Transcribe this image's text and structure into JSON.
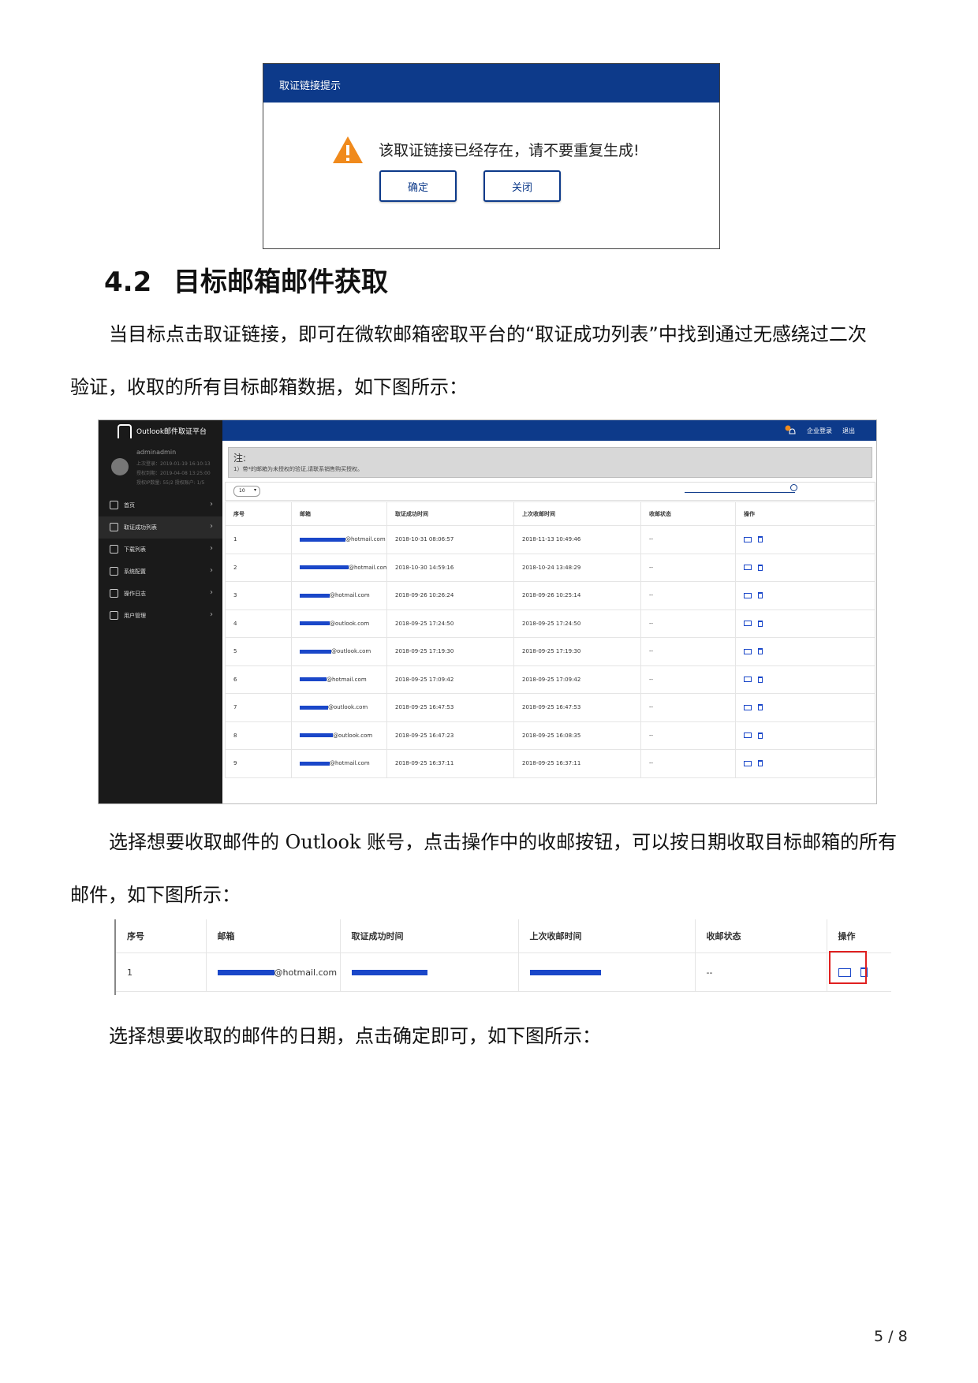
{
  "dialog": {
    "title": "取证链接提示",
    "message": "该取证链接已经存在，请不要重复生成!",
    "confirm_label": "确定",
    "close_label": "关闭",
    "header_color": "#0d3a8a",
    "warning_color": "#f08a1c"
  },
  "section": {
    "number": "4.2",
    "title": "目标邮箱邮件获取"
  },
  "para1": {
    "line1": "当目标点击取证链接，即可在微软邮箱密取平台的“取证成功列表”中找到通过无感绕过二次",
    "line2": "验证，收取的所有目标邮箱数据，如下图所示："
  },
  "admin": {
    "brand": "Outlook邮件取证平台",
    "badge": "1",
    "top_links": [
      "企业登录",
      "退出"
    ],
    "user": {
      "name": "adminadmin",
      "lines": [
        "上次登录：2019-01-19 16:10:13",
        "授权到期：2019-04-08 13:25:00",
        "授权IP数量: 55/2 授权账户: 1/5"
      ]
    },
    "menu": [
      {
        "label": "首页",
        "icon": "home-icon",
        "active": false
      },
      {
        "label": "取证成功列表",
        "icon": "list-icon",
        "active": true
      },
      {
        "label": "下载列表",
        "icon": "download-icon",
        "active": false
      },
      {
        "label": "系统配置",
        "icon": "settings-icon",
        "active": false
      },
      {
        "label": "操作日志",
        "icon": "log-icon",
        "active": false
      },
      {
        "label": "用户管理",
        "icon": "users-icon",
        "active": false
      }
    ],
    "note_title": "注:",
    "note_text": "1）带*的邮箱为未授权的验证,请联系销售购买授权。",
    "page_size": "10",
    "columns": [
      "序号",
      "邮箱",
      "取证成功时间",
      "上次收邮时间",
      "收邮状态",
      "操作"
    ],
    "rows": [
      {
        "id": "1",
        "redact_w": 58,
        "email": "@hotmail.com",
        "success": "2018-10-31 08:06:57",
        "last": "2018-11-13 10:49:46",
        "status": "--"
      },
      {
        "id": "2",
        "redact_w": 62,
        "email": "@hotmail.com",
        "success": "2018-10-30 14:59:16",
        "last": "2018-10-24 13:48:29",
        "status": "--"
      },
      {
        "id": "3",
        "redact_w": 38,
        "email": "@hotmail.com",
        "success": "2018-09-26 10:26:24",
        "last": "2018-09-26 10:25:14",
        "status": "--"
      },
      {
        "id": "4",
        "redact_w": 38,
        "email": "@outlook.com",
        "success": "2018-09-25 17:24:50",
        "last": "2018-09-25 17:24:50",
        "status": "--"
      },
      {
        "id": "5",
        "redact_w": 40,
        "email": "@outlook.com",
        "success": "2018-09-25 17:19:30",
        "last": "2018-09-25 17:19:30",
        "status": "--"
      },
      {
        "id": "6",
        "redact_w": 34,
        "email": "@hotmail.com",
        "success": "2018-09-25 17:09:42",
        "last": "2018-09-25 17:09:42",
        "status": "--"
      },
      {
        "id": "7",
        "redact_w": 36,
        "email": "@outlook.com",
        "success": "2018-09-25 16:47:53",
        "last": "2018-09-25 16:47:53",
        "status": "--"
      },
      {
        "id": "8",
        "redact_w": 42,
        "email": "@outlook.com",
        "success": "2018-09-25 16:47:23",
        "last": "2018-09-25 16:08:35",
        "status": "--"
      },
      {
        "id": "9",
        "redact_w": 38,
        "email": "@hotmail.com",
        "success": "2018-09-25 16:37:11",
        "last": "2018-09-25 16:37:11",
        "status": "--"
      }
    ]
  },
  "para2": {
    "line1_pre": "选择想要收取邮件的",
    "line1_code": "Outlook",
    "line1_post": "账号，点击操作中的收邮按钮，可以按日期收取目标邮箱的所有",
    "line2": "邮件，如下图所示："
  },
  "single": {
    "columns": [
      "序号",
      "邮箱",
      "取证成功时间",
      "上次收邮时间",
      "收邮状态",
      "操作"
    ],
    "row": {
      "id": "1",
      "email": "@hotmail.com",
      "status": "--"
    }
  },
  "para3": {
    "line1": "选择想要收取的邮件的日期，点击确定即可，如下图所示："
  },
  "page_number": "5 / 8"
}
